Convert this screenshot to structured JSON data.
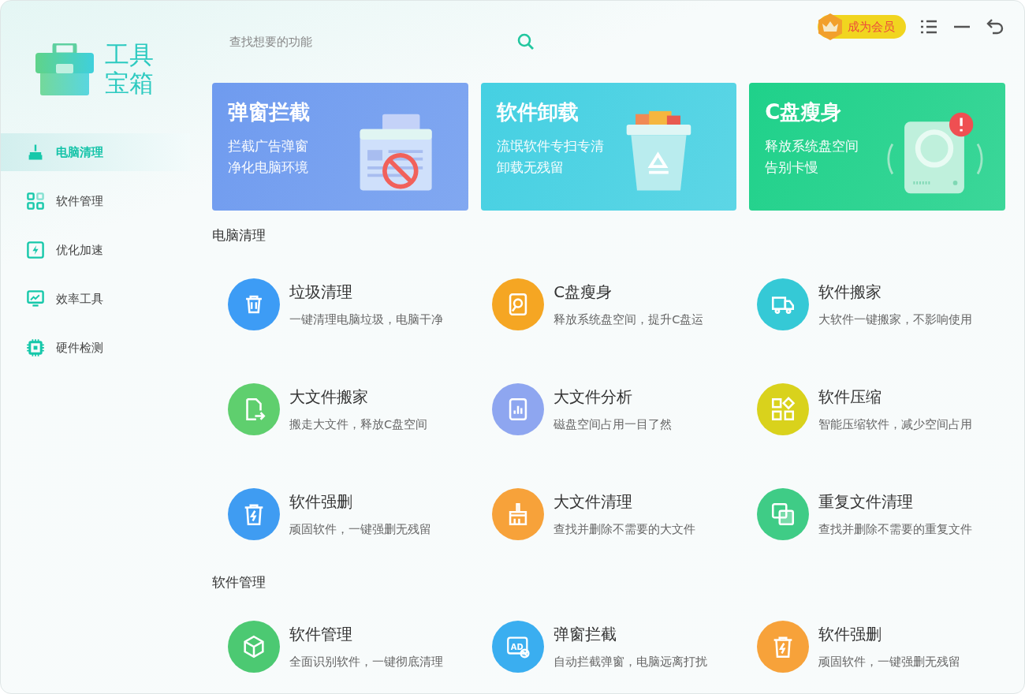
{
  "app_title": "工具宝箱",
  "search": {
    "placeholder": "查找想要的功能"
  },
  "vip_button": "成为会员",
  "sidebar": {
    "items": [
      {
        "label": "电脑清理",
        "selected": true
      },
      {
        "label": "软件管理",
        "selected": false
      },
      {
        "label": "优化加速",
        "selected": false
      },
      {
        "label": "效率工具",
        "selected": false
      },
      {
        "label": "硬件检测",
        "selected": false
      }
    ]
  },
  "banners": [
    {
      "title": "弹窗拦截",
      "lines": [
        "拦截广告弹窗",
        "净化电脑环境"
      ],
      "color": "#6f9bef"
    },
    {
      "title": "软件卸载",
      "lines": [
        "流氓软件专扫专清",
        "卸载无残留"
      ],
      "color": "#45d0e2"
    },
    {
      "title": "C盘瘦身",
      "lines": [
        "释放系统盘空间",
        "告别卡慢"
      ],
      "color": "#1fd18a"
    }
  ],
  "sections": [
    {
      "title": "电脑清理",
      "items": [
        {
          "name": "垃圾清理",
          "desc": "一键清理电脑垃圾，电脑干净",
          "color": "#3d9cf5"
        },
        {
          "name": "C盘瘦身",
          "desc": "释放系统盘空间，提升C盘运",
          "color": "#f5a623"
        },
        {
          "name": "软件搬家",
          "desc": "大软件一键搬家，不影响使用",
          "color": "#35c9d6"
        },
        {
          "name": "大文件搬家",
          "desc": "搬走大文件，释放C盘空间",
          "color": "#5fcf6e"
        },
        {
          "name": "大文件分析",
          "desc": "磁盘空间占用一目了然",
          "color": "#8ea6f0"
        },
        {
          "name": "软件压缩",
          "desc": "智能压缩软件，减少空间占用",
          "color": "#d9d21c"
        },
        {
          "name": "软件强删",
          "desc": "顽固软件，一键强删无残留",
          "color": "#3f9cf2"
        },
        {
          "name": "大文件清理",
          "desc": "查找并删除不需要的大文件",
          "color": "#f7a23a"
        },
        {
          "name": "重复文件清理",
          "desc": "查找并删除不需要的重复文件",
          "color": "#3fcc86"
        }
      ]
    },
    {
      "title": "软件管理",
      "items": [
        {
          "name": "软件管理",
          "desc": "全面识别软件，一键彻底清理",
          "color": "#4cc972"
        },
        {
          "name": "弹窗拦截",
          "desc": "自动拦截弹窗，电脑远离打扰",
          "color": "#3aaef0",
          "icon_text": "AD"
        },
        {
          "name": "软件强删",
          "desc": "顽固软件，一键强删无残留",
          "color": "#f7a23a"
        }
      ]
    }
  ]
}
